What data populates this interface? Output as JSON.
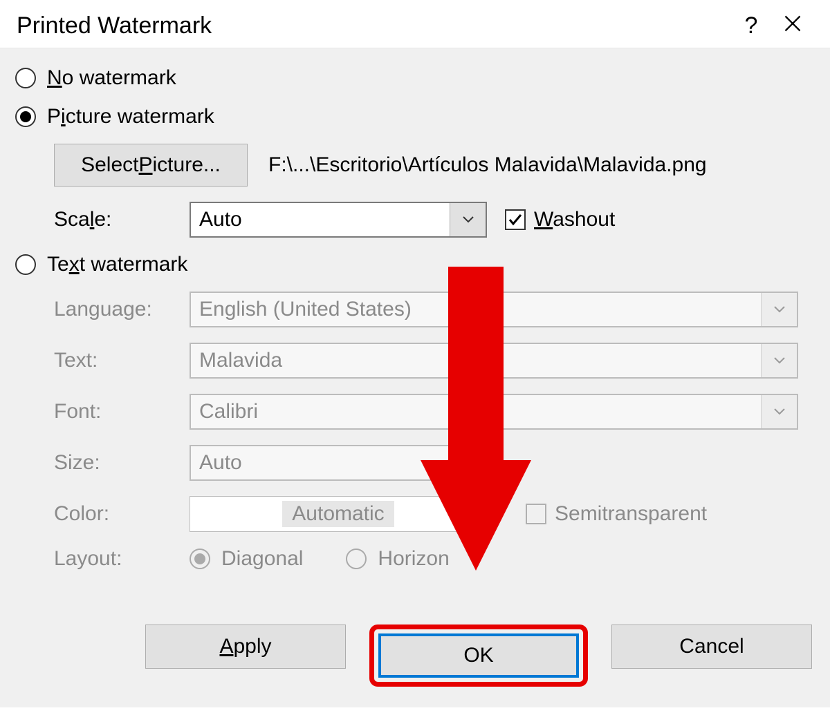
{
  "title": "Printed Watermark",
  "radios": {
    "no_watermark": "No watermark",
    "no_watermark_pre": "N",
    "no_watermark_post": "o watermark",
    "picture_watermark": "Picture watermark",
    "picture_pre": "P",
    "picture_u": "i",
    "picture_post": "cture watermark",
    "text_watermark": "Text watermark",
    "text_pre": "Te",
    "text_u": "x",
    "text_post": "t watermark"
  },
  "picture": {
    "select_button": "Select Picture...",
    "select_pre": "Select ",
    "select_u": "P",
    "select_post": "icture...",
    "path": "F:\\...\\Escritorio\\Artículos Malavida\\Malavida.png",
    "scale_label": "Scale:",
    "scale_pre": "Sca",
    "scale_u": "l",
    "scale_post": "e:",
    "scale_value": "Auto",
    "washout": "Washout",
    "washout_u": "W",
    "washout_post": "ashout"
  },
  "text": {
    "language_label": "Language:",
    "language_value": "English (United States)",
    "text_label": "Text:",
    "text_value": "Malavida",
    "font_label": "Font:",
    "font_value": "Calibri",
    "size_label": "Size:",
    "size_value": "Auto",
    "color_label": "Color:",
    "color_value": "Automatic",
    "semitransparent": "Semitransparent",
    "layout_label": "Layout:",
    "diagonal": "Diagonal",
    "horizontal_pre": "Horizon",
    "horizontal": "Horizontal"
  },
  "buttons": {
    "apply": "Apply",
    "apply_u": "A",
    "apply_post": "pply",
    "ok": "OK",
    "cancel": "Cancel"
  },
  "annotation": {
    "arrow_color": "#e60000"
  }
}
